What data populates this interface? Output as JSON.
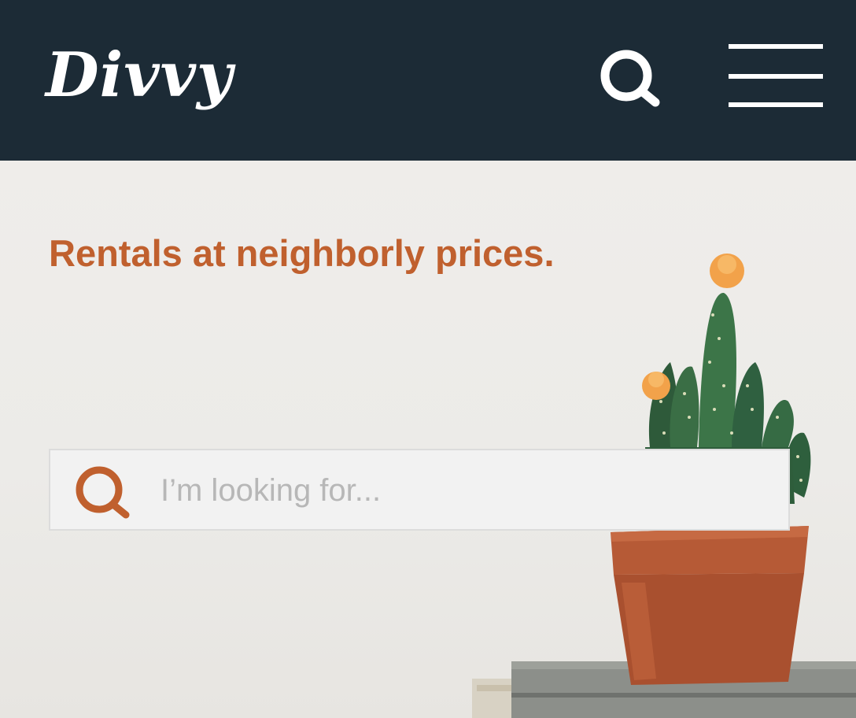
{
  "header": {
    "logo_text": "Divvy",
    "search_icon": "search-icon",
    "menu_icon": "hamburger-menu-icon",
    "background": "#1c2b36"
  },
  "hero": {
    "tagline": "Rentals at neighborly prices.",
    "tagline_color": "#c0602e",
    "image": "potted-cactus-on-books"
  },
  "search": {
    "placeholder": "I’m looking for...",
    "value": "",
    "icon": "search-icon",
    "icon_color": "#c0602e"
  }
}
